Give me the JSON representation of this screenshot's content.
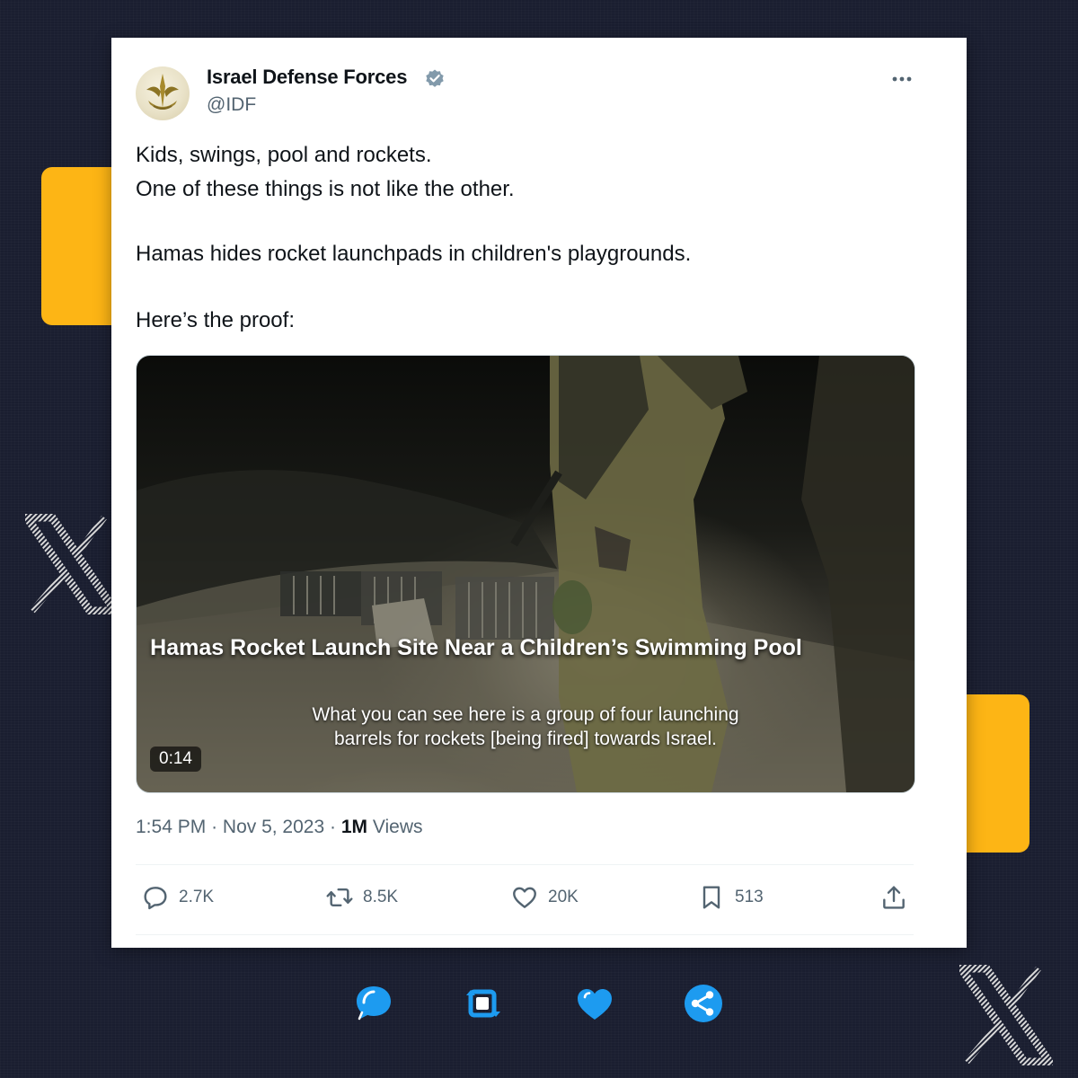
{
  "colors": {
    "background": "#1a1e30",
    "accent": "#fdb515",
    "card": "#ffffff",
    "text_primary": "#0f1419",
    "text_secondary": "#536471",
    "verified_badge": "#829aab",
    "bottom_icons": "#1d9bf0"
  },
  "tweet": {
    "author": {
      "name": "Israel Defense Forces",
      "handle": "@IDF",
      "verified": true,
      "avatar_icon": "idf-emblem-icon"
    },
    "text_lines": [
      "Kids, swings, pool and rockets.",
      "One of these things is not like the other.",
      "Hamas hides rocket launchpads in children's playgrounds.",
      "Here’s the proof:"
    ],
    "media": {
      "type": "video",
      "title_overlay": "Hamas Rocket Launch Site Near a Children’s Swimming Pool",
      "subtitle_lines": [
        "What you can see here is a group of four launching",
        "barrels for rockets [being fired] towards Israel."
      ],
      "duration": "0:14"
    },
    "meta": {
      "time": "1:54 PM",
      "separator": "·",
      "date": "Nov 5, 2023",
      "views_count": "1M",
      "views_label": "Views"
    },
    "actions": {
      "reply": {
        "icon": "reply-icon",
        "count": "2.7K"
      },
      "retweet": {
        "icon": "retweet-icon",
        "count": "8.5K"
      },
      "like": {
        "icon": "heart-icon",
        "count": "20K"
      },
      "bookmark": {
        "icon": "bookmark-icon",
        "count": "513"
      },
      "share": {
        "icon": "share-icon"
      }
    }
  },
  "bottom_icons": [
    "chat-bubble-icon",
    "retweet-icon",
    "heart-icon",
    "share-icon"
  ],
  "decorations": [
    "x-logo-icon",
    "x-logo-icon"
  ]
}
